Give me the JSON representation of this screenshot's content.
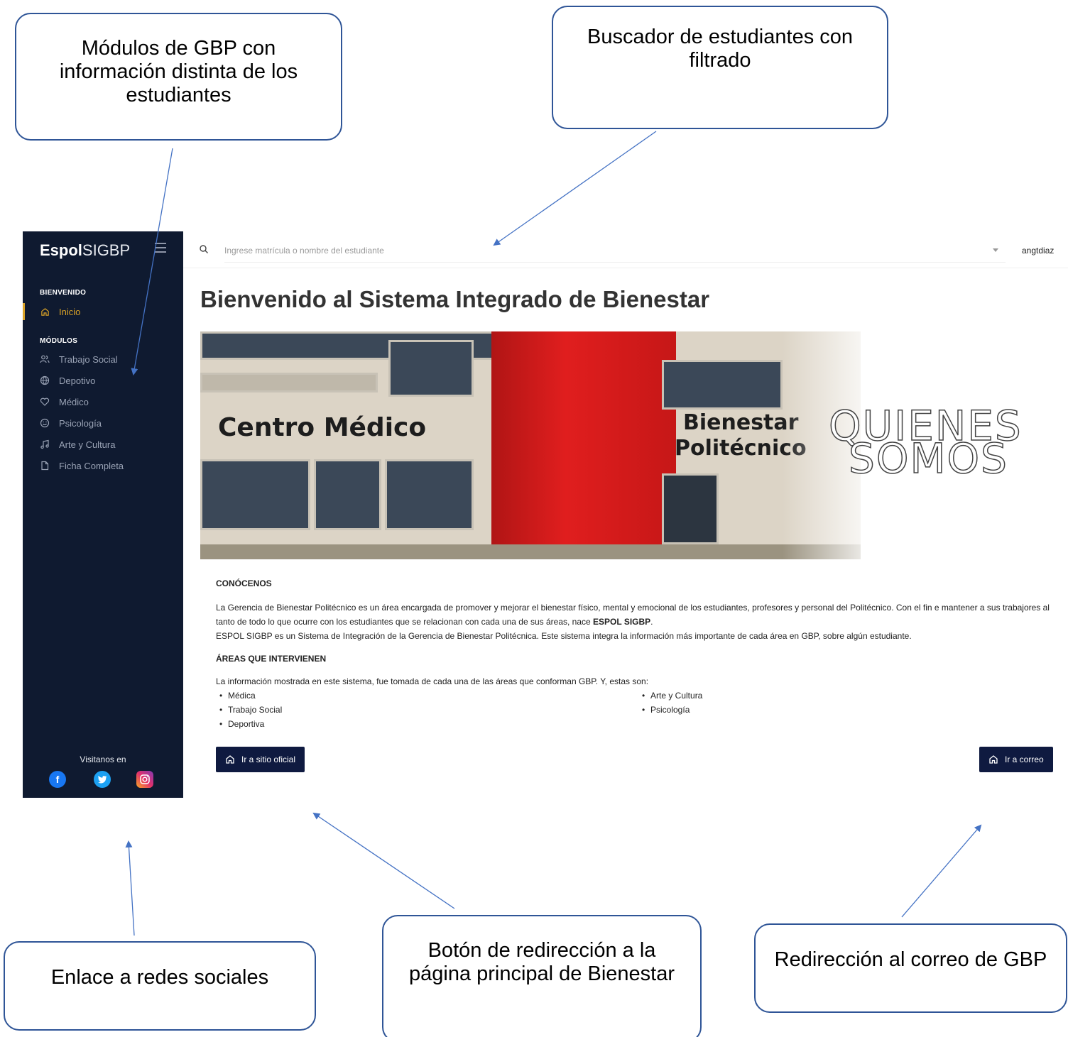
{
  "callouts": {
    "modulos": "Módulos de GBP con información distinta de los estudiantes",
    "buscador": "Buscador de estudiantes con filtrado",
    "redes": "Enlace a redes sociales",
    "boton_bienestar": "Botón de redirección a la página principal de Bienestar",
    "correo": "Redirección al correo de GBP"
  },
  "sidebar": {
    "brand_bold": "Espol",
    "brand_light": "SIGBP",
    "section_welcome": "BIENVENIDO",
    "home": {
      "label": "Inicio",
      "icon": "home-icon"
    },
    "section_modules": "MÓDULOS",
    "items": [
      {
        "label": "Trabajo Social",
        "icon": "users-icon"
      },
      {
        "label": "Depotivo",
        "icon": "ball-icon"
      },
      {
        "label": "Médico",
        "icon": "heart-icon"
      },
      {
        "label": "Psicología",
        "icon": "smile-icon"
      },
      {
        "label": "Arte y Cultura",
        "icon": "music-icon"
      },
      {
        "label": "Ficha Completa",
        "icon": "file-icon"
      }
    ],
    "visit_label": "Visitanos en",
    "social": [
      "facebook-icon",
      "twitter-icon",
      "instagram-icon"
    ]
  },
  "topbar": {
    "search_placeholder": "Ingrese matrícula o nombre del estudiante",
    "user": "angtdiaz"
  },
  "main": {
    "title": "Bienvenido al Sistema Integrado de Bienestar",
    "banner": {
      "sign_left": "Centro Médico",
      "sign_right_1": "Bienestar",
      "sign_right_2": "Politécnico",
      "quienes": "QUIENES",
      "somos": "SOMOS"
    },
    "conocenos_heading": "CONÓCENOS",
    "conocenos_p1_start": "La Gerencia de Bienestar Politécnico es un área encargada de promover y mejorar el bienestar físico, mental y emocional de los estudiantes, profesores y personal del Politécnico. Con el fin e mantener a sus trabajores al tanto de todo lo que ocurre con los estudiantes que se relacionan con cada una de sus áreas, nace ",
    "conocenos_p1_bold": "ESPOL SIGBP",
    "conocenos_p1_end": ".",
    "conocenos_p2": "ESPOL SIGBP es un Sistema de Integración de la Gerencia de Bienestar Politécnica. Este sistema integra la información más importante de cada área en GBP, sobre algún estudiante.",
    "areas_heading": "ÁREAS QUE INTERVIENEN",
    "areas_intro": "La información mostrada en este sistema, fue tomada de cada una de las áreas que conforman GBP. Y, estas son:",
    "areas_col1": [
      "Médica",
      "Trabajo Social",
      "Deportiva"
    ],
    "areas_col2": [
      "Arte y Cultura",
      "Psicología"
    ],
    "btn_site": "Ir a sitio oficial",
    "btn_mail": "Ir a correo"
  },
  "colors": {
    "sidebar_bg": "#0f1a30",
    "accent": "#d9a227",
    "button_bg": "#0f1a40",
    "callout_border": "#2f5597"
  }
}
